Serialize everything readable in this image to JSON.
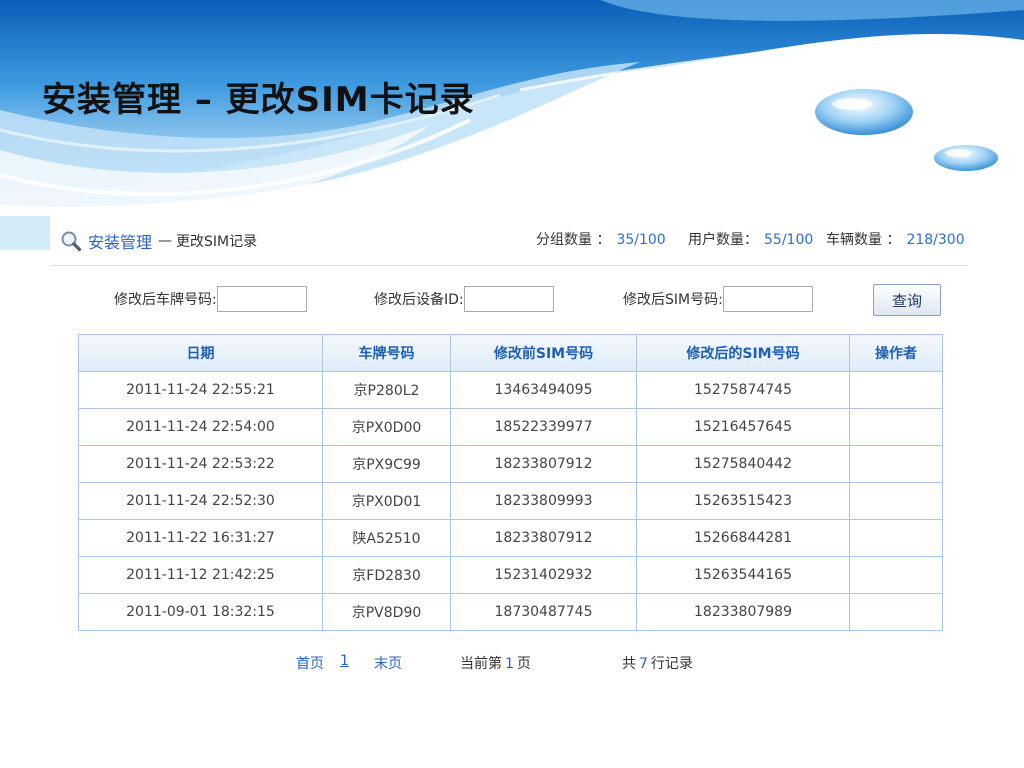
{
  "slide": {
    "title": "安装管理 – 更改SIM卡记录"
  },
  "header": {
    "module": "安装管理",
    "separator": "—",
    "page": "更改SIM记录",
    "stats": [
      {
        "label": "分组数量 ：",
        "value": "35/100"
      },
      {
        "label": "用户数量：",
        "value": "55/100"
      },
      {
        "label": "车辆数量 ：",
        "value": "218/300"
      }
    ]
  },
  "filters": {
    "plate_label": "修改后车牌号码:",
    "plate_value": "",
    "device_label": "修改后设备ID:",
    "device_value": "",
    "sim_label": "修改后SIM号码:",
    "sim_value": "",
    "query_label": "查询"
  },
  "table": {
    "headers": [
      "日期",
      "车牌号码",
      "修改前SIM号码",
      "修改后的SIM号码",
      "操作者"
    ],
    "rows": [
      [
        "2011-11-24 22:55:21",
        "京P280L2",
        "13463494095",
        "15275874745",
        ""
      ],
      [
        "2011-11-24 22:54:00",
        "京PX0D00",
        "18522339977",
        "15216457645",
        ""
      ],
      [
        "2011-11-24 22:53:22",
        "京PX9C99",
        "18233807912",
        "15275840442",
        ""
      ],
      [
        "2011-11-24 22:52:30",
        "京PX0D01",
        "18233809993",
        "15263515423",
        ""
      ],
      [
        "2011-11-22 16:31:27",
        "陕A52510",
        "18233807912",
        "15266844281",
        ""
      ],
      [
        "2011-11-12 21:42:25",
        "京FD2830",
        "15231402932",
        "15263544165",
        ""
      ],
      [
        "2011-09-01 18:32:15",
        "京PV8D90",
        "18730487745",
        "18233807989",
        ""
      ]
    ]
  },
  "pagination": {
    "first": "首页",
    "page_number": "1",
    "last": "末页",
    "current_prefix": "当前第",
    "current_page": "1",
    "current_suffix": "页",
    "total_prefix": "共",
    "total_count": "7",
    "total_suffix": "行记录"
  },
  "colors": {
    "accent": "#2a63c6",
    "table_border": "#aac6e2",
    "header_text": "#1f5fb3"
  }
}
